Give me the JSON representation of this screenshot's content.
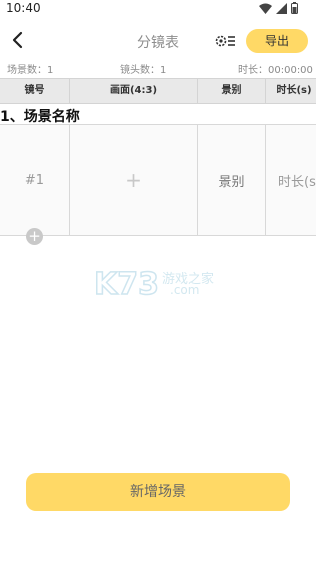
{
  "status_bar": {
    "time": "10:40"
  },
  "header": {
    "title": "分镜表",
    "export_label": "导出"
  },
  "summary": {
    "scene_count": "场景数：1",
    "shot_count": "镜头数：1",
    "duration": "时长：00:00:00"
  },
  "table": {
    "columns": [
      "镜号",
      "画面(4:3)",
      "景别",
      "时长(s)"
    ]
  },
  "scene": {
    "title": "1、场景名称",
    "shots": [
      {
        "number": "#1",
        "image_placeholder": "+",
        "shot_type": "景别",
        "duration": "时长(s)"
      }
    ]
  },
  "watermark": {
    "logo": "K73",
    "text": "游戏之家",
    "domain": ".com"
  },
  "footer": {
    "add_scene_label": "新增场景"
  },
  "colors": {
    "accent": "#ffd966",
    "header_bg": "#e9e9e9"
  }
}
